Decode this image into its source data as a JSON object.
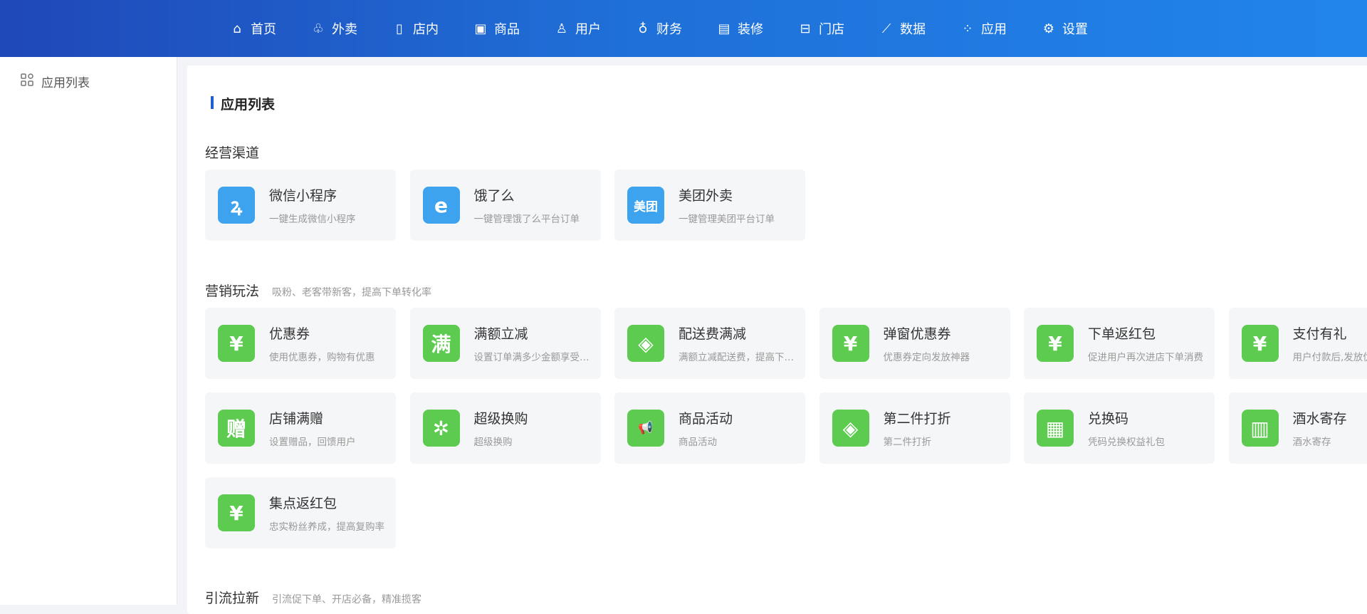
{
  "nav": [
    {
      "label": "首页",
      "icon": "home-icon",
      "g": "⌂"
    },
    {
      "label": "外卖",
      "icon": "delivery-icon",
      "g": "♧"
    },
    {
      "label": "店内",
      "icon": "store-inside-icon",
      "g": "▯"
    },
    {
      "label": "商品",
      "icon": "goods-icon",
      "g": "▣"
    },
    {
      "label": "用户",
      "icon": "user-icon",
      "g": "♙"
    },
    {
      "label": "财务",
      "icon": "money-bag-icon",
      "g": "♁"
    },
    {
      "label": "装修",
      "icon": "decoration-icon",
      "g": "▤"
    },
    {
      "label": "门店",
      "icon": "shop-icon",
      "g": "⊟"
    },
    {
      "label": "数据",
      "icon": "chart-icon",
      "g": "⟋"
    },
    {
      "label": "应用",
      "icon": "apps-icon",
      "g": "⁘"
    },
    {
      "label": "设置",
      "icon": "gear-icon",
      "g": "⚙"
    }
  ],
  "sidebar": {
    "item": "应用列表"
  },
  "page_title": "应用列表",
  "sections": [
    {
      "title": "经营渠道",
      "subtitle": "",
      "cards": [
        {
          "title": "微信小程序",
          "desc": "一键生成微信小程序",
          "icon": "mini-program-icon",
          "g": "ꝝ",
          "color": "blue"
        },
        {
          "title": "饿了么",
          "desc": "一键管理饿了么平台订单",
          "icon": "eleme-icon",
          "g": "e",
          "color": "blue"
        },
        {
          "title": "美团外卖",
          "desc": "一键管理美团平台订单",
          "icon": "meituan-icon",
          "g": "美团",
          "color": "blue"
        }
      ]
    },
    {
      "title": "营销玩法",
      "subtitle": "吸粉、老客带新客，提高下单转化率",
      "cards": [
        {
          "title": "优惠券",
          "desc": "使用优惠券，购物有优惠",
          "icon": "coupon-icon",
          "g": "¥",
          "color": "green"
        },
        {
          "title": "满额立减",
          "desc": "设置订单满多少金额享受立减",
          "icon": "full-reduce-icon",
          "g": "满",
          "color": "green"
        },
        {
          "title": "配送费满减",
          "desc": "满额立减配送费，提高下单率",
          "icon": "tag-icon",
          "g": "◈",
          "color": "green"
        },
        {
          "title": "弹窗优惠券",
          "desc": "优惠券定向发放神器",
          "icon": "popup-coupon-icon",
          "g": "¥",
          "color": "green"
        },
        {
          "title": "下单返红包",
          "desc": "促进用户再次进店下单消费",
          "icon": "red-packet-icon",
          "g": "¥",
          "color": "green"
        },
        {
          "title": "支付有礼",
          "desc": "用户付款后,发放优惠券",
          "icon": "pay-gift-icon",
          "g": "¥",
          "color": "green"
        },
        {
          "title": "店铺满赠",
          "desc": "设置赠品，回馈用户",
          "icon": "gift-char-icon",
          "g": "赠",
          "color": "green"
        },
        {
          "title": "超级换购",
          "desc": "超级换购",
          "icon": "wheel-icon",
          "g": "✲",
          "color": "green"
        },
        {
          "title": "商品活动",
          "desc": "商品活动",
          "icon": "megaphone-icon",
          "g": "📢",
          "color": "green"
        },
        {
          "title": "第二件打折",
          "desc": "第二件打折",
          "icon": "discount-tag-icon",
          "g": "◈",
          "color": "green"
        },
        {
          "title": "兑换码",
          "desc": "凭码兑换权益礼包",
          "icon": "redeem-gift-icon",
          "g": "▦",
          "color": "green"
        },
        {
          "title": "酒水寄存",
          "desc": "酒水寄存",
          "icon": "storage-icon",
          "g": "▥",
          "color": "green"
        },
        {
          "title": "集点返红包",
          "desc": "忠实粉丝养成，提高复购率",
          "icon": "red-packet-icon",
          "g": "¥",
          "color": "green"
        }
      ]
    },
    {
      "title": "引流拉新",
      "subtitle": "引流促下单、开店必备，精准揽客",
      "cards": []
    }
  ]
}
